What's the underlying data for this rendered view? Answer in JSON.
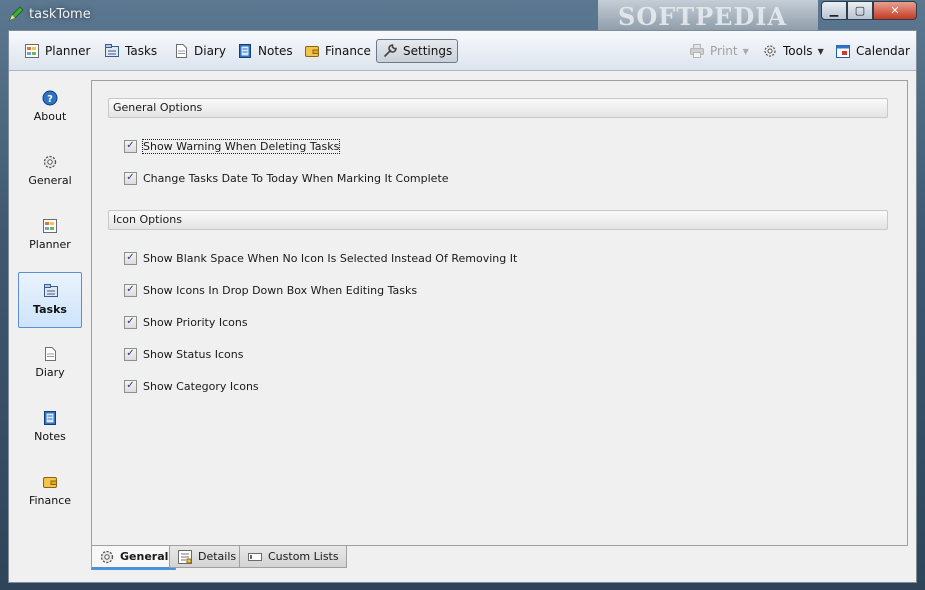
{
  "window": {
    "title": "taskTome",
    "watermark": "SOFTPEDIA"
  },
  "toolbar": {
    "left": [
      {
        "label": "Planner",
        "icon": "planner-icon"
      },
      {
        "label": "Tasks",
        "icon": "tasks-icon"
      },
      {
        "label": "Diary",
        "icon": "diary-icon"
      },
      {
        "label": "Notes",
        "icon": "notes-icon"
      },
      {
        "label": "Finance",
        "icon": "finance-icon"
      },
      {
        "label": "Settings",
        "icon": "wrench-icon",
        "active": true
      }
    ],
    "right": [
      {
        "label": "Print",
        "icon": "printer-icon",
        "disabled": true
      },
      {
        "label": "Tools",
        "icon": "gear-icon"
      },
      {
        "label": "Calendar",
        "icon": "calendar-icon"
      }
    ]
  },
  "sidebar": {
    "items": [
      {
        "label": "About",
        "icon": "help-icon"
      },
      {
        "label": "General",
        "icon": "gear-icon"
      },
      {
        "label": "Planner",
        "icon": "planner-icon"
      },
      {
        "label": "Tasks",
        "icon": "tasks-icon",
        "active": true
      },
      {
        "label": "Diary",
        "icon": "diary-icon"
      },
      {
        "label": "Notes",
        "icon": "notes-icon"
      },
      {
        "label": "Finance",
        "icon": "finance-icon"
      }
    ]
  },
  "general_options": {
    "title": "General Options",
    "options": [
      {
        "label": "Show Warning When Deleting Tasks",
        "checked": true
      },
      {
        "label": "Change Tasks Date To Today When Marking It Complete",
        "checked": true
      }
    ]
  },
  "icon_options": {
    "title": "Icon Options",
    "options": [
      {
        "label": "Show Blank Space When No Icon Is Selected Instead Of Removing It",
        "checked": true
      },
      {
        "label": "Show Icons In Drop Down Box When Editing Tasks",
        "checked": true
      },
      {
        "label": "Show Priority Icons",
        "checked": true
      },
      {
        "label": "Show Status Icons",
        "checked": true
      },
      {
        "label": "Show Category Icons",
        "checked": true
      }
    ]
  },
  "tabs": [
    {
      "label": "General",
      "active": true
    },
    {
      "label": "Details"
    },
    {
      "label": "Custom Lists"
    }
  ],
  "colors": {
    "accent": "#4f91d6",
    "check": "#2a3d78"
  }
}
